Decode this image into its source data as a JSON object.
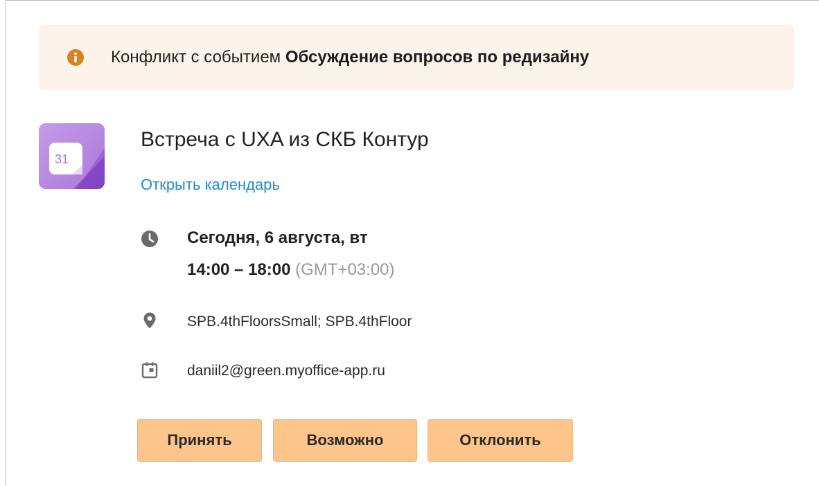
{
  "conflict": {
    "prefix": "Конфликт с событием",
    "event_name": "Обсуждение вопросов по редизайну",
    "icon": "info-icon",
    "icon_color": "#d9821e",
    "background": "#fcf4ea"
  },
  "event": {
    "app_icon": "calendar-app-icon",
    "app_icon_day": "31",
    "title": "Встреча с UXA из СКБ Контур",
    "open_calendar_label": "Открыть календарь",
    "date": "Сегодня, 6 августа, вт",
    "time_range": "14:00 – 18:00",
    "timezone": "(GMT+03:00)",
    "location": "SPB.4thFloorsSmall; SPB.4thFloor",
    "calendar_owner": "daniil2@green.myoffice-app.ru",
    "link_color": "#1a8bd6"
  },
  "icons": {
    "time": "clock-icon",
    "location": "location-pin-icon",
    "calendar": "calendar-icon"
  },
  "actions": {
    "accept_label": "Принять",
    "maybe_label": "Возможно",
    "decline_label": "Отклонить",
    "button_color": "#fdc58c"
  }
}
